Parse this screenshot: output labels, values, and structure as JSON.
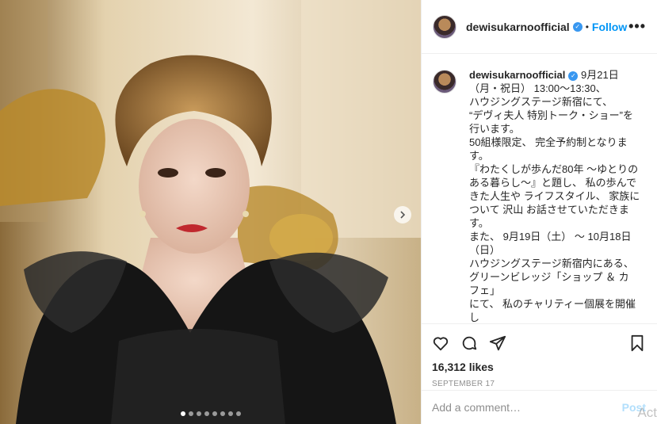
{
  "post": {
    "username": "dewisukarnoofficial",
    "separator": "•",
    "follow_label": "Follow",
    "more_label": "•••",
    "caption": "9月21日\n（月・祝日） 13:00〜13:30、\nハウジングステージ新宿にて、\n“デヴィ夫人 特別トーク・ショー”を\n行います。\n50組様限定、 完全予約制となりま\nす。\n『わたくしが歩んだ80年 〜ゆとりの\nある暮らし〜』と題し、 私の歩んで\nきた人生や ライフスタイル、 家族に\nついて 沢山 お話させていただきま\nす。\nまた、 9月19日（土） 〜 10月18日\n（日）\nハウジングステージ新宿内にある、\nグリーンビレッジ「ショップ ＆ カ\nフェ」\nにて、 私のチャリティー個展を開催\nし\n私の絵画や オリジナル グッズ",
    "likes": "16,312 likes",
    "date": "SEPTEMBER 17",
    "comment_placeholder": "Add a comment…",
    "post_label": "Post",
    "watermark": "Act"
  },
  "carousel": {
    "slides": 8,
    "active": 0
  },
  "icons": {
    "verified": "verified-badge-icon",
    "like": "heart-icon",
    "comment": "comment-bubble-icon",
    "share": "paper-plane-icon",
    "save": "bookmark-icon",
    "next": "chevron-right-icon"
  },
  "colors": {
    "accent": "#0095f6",
    "verified": "#3897f0",
    "muted": "#8e8e8e"
  }
}
